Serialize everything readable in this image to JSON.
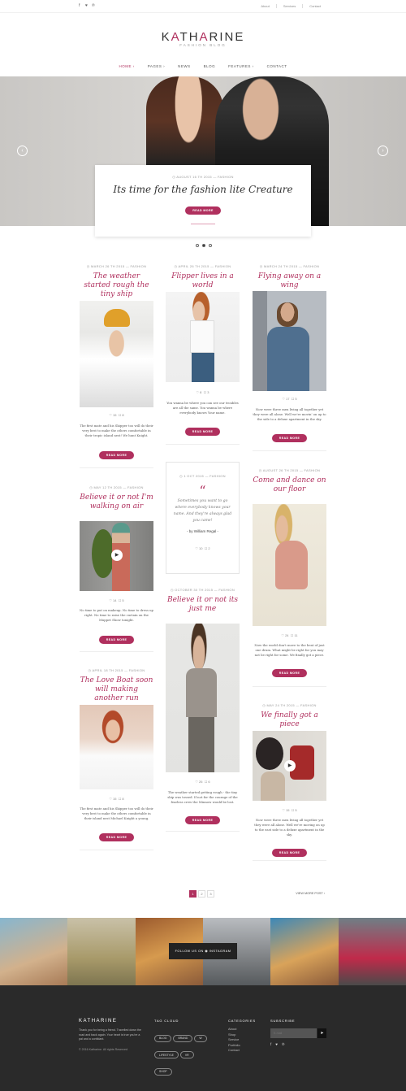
{
  "topbar": {
    "social": [
      "f",
      "♥",
      "℗"
    ],
    "links": [
      "About",
      "Services",
      "Contact"
    ]
  },
  "logo": {
    "pre": "K",
    "a1": "A",
    "mid": "TH",
    "a2": "A",
    "post": "RINE",
    "tagline": "FASHION BLOG"
  },
  "nav": [
    "HOME ›",
    "PAGES ›",
    "NEWS",
    "BLOG",
    "FEATURES ›",
    "CONTACT"
  ],
  "hero": {
    "meta": "◷ AUGUST 16 TH 2015 — FASHION",
    "title": "Its time for the fashion lite Creature",
    "button": "READ MORE"
  },
  "posts": [
    {
      "meta": "◷ MARCH 26 TH 2015 — FASHION",
      "title": "The weather started rough the tiny ship",
      "likes": "♡ 15",
      "comments": "☐ 8",
      "excerpt": "The first mate and his Skipper too will do their very best to make the others comfortable in their tropic island nest! We hunt Knight.",
      "button": "READ MORE"
    },
    {
      "meta": "◷ APRIL 26 TH 2015 — FASHION",
      "title": "Flipper lives in a world",
      "likes": "♡ 8",
      "comments": "☐ 3",
      "excerpt": "You wanna be where you can see our troubles are all the same. You wanna be where everybody knows Your name.",
      "button": "READ MORE"
    },
    {
      "meta": "◷ MARCH 24 TH 2015 — FASHION",
      "title": "Flying away on a wing",
      "likes": "♡ 17",
      "comments": "☐ 5",
      "excerpt": "Now were three men living all together yet they were all alone. Well we're movin' on up to the side to a deluxe apartment in the sky.",
      "button": "READ MORE"
    },
    {
      "meta": "◷ MAY 12 TH 2015 — FASHION",
      "title": "Believe it or not I'm walking on air",
      "likes": "♡ 14",
      "comments": "☐ 5",
      "excerpt": "No time to put on makeup. No time to dress up right. No time to raise the curtain on the Muppet Show tonight.",
      "button": "READ MORE"
    },
    {
      "meta": "◷ 1 OCT 2015 — FASHION",
      "quote": "Sometimes you want to go where everybody knows your name. And they're always glad you came!",
      "author": "- by William Regal -",
      "likes": "♡ 10",
      "comments": "☐ 2"
    },
    {
      "meta": "◷ AUGUST 26 TH 2015 — FASHION",
      "title": "Come and dance on our floor",
      "likes": "♡ 24",
      "comments": "☐ 11",
      "excerpt": "Now the world don't move to the beat of just one drum. What might be right for you may not be right for some. We finally got a piece.",
      "button": "READ MORE"
    },
    {
      "meta": "◷ APRIL 18 TH 2015 — FASHION",
      "title": "The Love Boat soon will making another run",
      "likes": "♡ 15",
      "comments": "☐ 8",
      "excerpt": "The first mate and his Skipper too will do their very best to make the others comfortable in their island nest Michael Knight a young.",
      "button": "READ MORE"
    },
    {
      "meta": "◷ OCTOBER 30 TH 2015 — FASHION",
      "title": "Believe it or not its just me",
      "likes": "♡ 26",
      "comments": "☐ 6",
      "excerpt": "The weather started getting rough - the tiny ship was tossed. If not for the courage of the fearless crew the Minnow would be lost.",
      "button": "READ MORE"
    },
    {
      "meta": "◷ MAY 24 TH 2015 — FASHION",
      "title": "We finally got a piece",
      "likes": "♡ 15",
      "comments": "☐ 5",
      "excerpt": "Now were three men living all together yet they were all alone. Well we're moving on up to the east side to a deluxe apartment in the sky.",
      "button": "READ MORE"
    }
  ],
  "pagination": [
    "1",
    "2",
    "3"
  ],
  "view_more": "VIEW MORE POST ›",
  "instagram": "FOLLOW US ON ◉ INSTAGRAM",
  "footer": {
    "logo": "KATHARINE",
    "about": "Thank you for being a friend. Travelled down the road and back again. Your heart is true you're a pal and a confidant.",
    "copyright": "© 2016 Katharine. All rights Reserved",
    "tag_cloud_title": "TAG CLOUD",
    "tags": [
      "BLOG",
      "BRAND",
      "W",
      "LIFESTYLE",
      "VR",
      "SHOP"
    ],
    "categories_title": "CATEGORIES",
    "categories": [
      "About",
      "Shop",
      "Service",
      "Portfolio",
      "Contact"
    ],
    "subscribe_title": "SUBSCRIBE",
    "email_placeholder": "E-mail",
    "social": [
      "f",
      "♥",
      "℗"
    ]
  }
}
